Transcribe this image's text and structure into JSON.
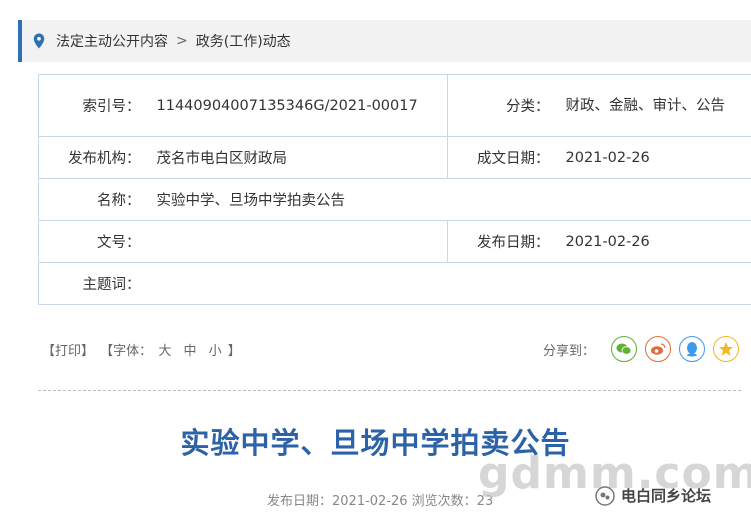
{
  "breadcrumb": {
    "items": [
      "法定主动公开内容",
      "政务(工作)动态"
    ],
    "separator": ">"
  },
  "meta": {
    "index_label": "索引号：",
    "index_value": "11440904007135346G/2021-00017",
    "category_label": "分类：",
    "category_value": "财政、金融、审计、公告",
    "publisher_label": "发布机构：",
    "publisher_value": "茂名市电白区财政局",
    "created_label": "成文日期：",
    "created_value": "2021-02-26",
    "name_label": "名称：",
    "name_value": "实验中学、旦场中学拍卖公告",
    "docno_label": "文号：",
    "docno_value": "",
    "pubdate_label": "发布日期：",
    "pubdate_value": "2021-02-26",
    "keywords_label": "主题词：",
    "keywords_value": ""
  },
  "tools": {
    "print": "【打印】",
    "font_open": "【字体：",
    "font_large": "大",
    "font_medium": "中",
    "font_small": "小",
    "font_close": "】"
  },
  "share": {
    "label": "分享到：",
    "icons": [
      "wechat-icon",
      "weibo-icon",
      "qq-icon",
      "qzone-icon"
    ]
  },
  "article": {
    "title": "实验中学、旦场中学拍卖公告",
    "meta": "发布日期：2021-02-26   浏览次数：23"
  },
  "watermark": {
    "domain": "gdmm.com",
    "badge": "电白同乡论坛"
  },
  "colors": {
    "accent": "#2f6fb3",
    "title": "#2c63a8",
    "table_border": "#c9d7e8"
  }
}
